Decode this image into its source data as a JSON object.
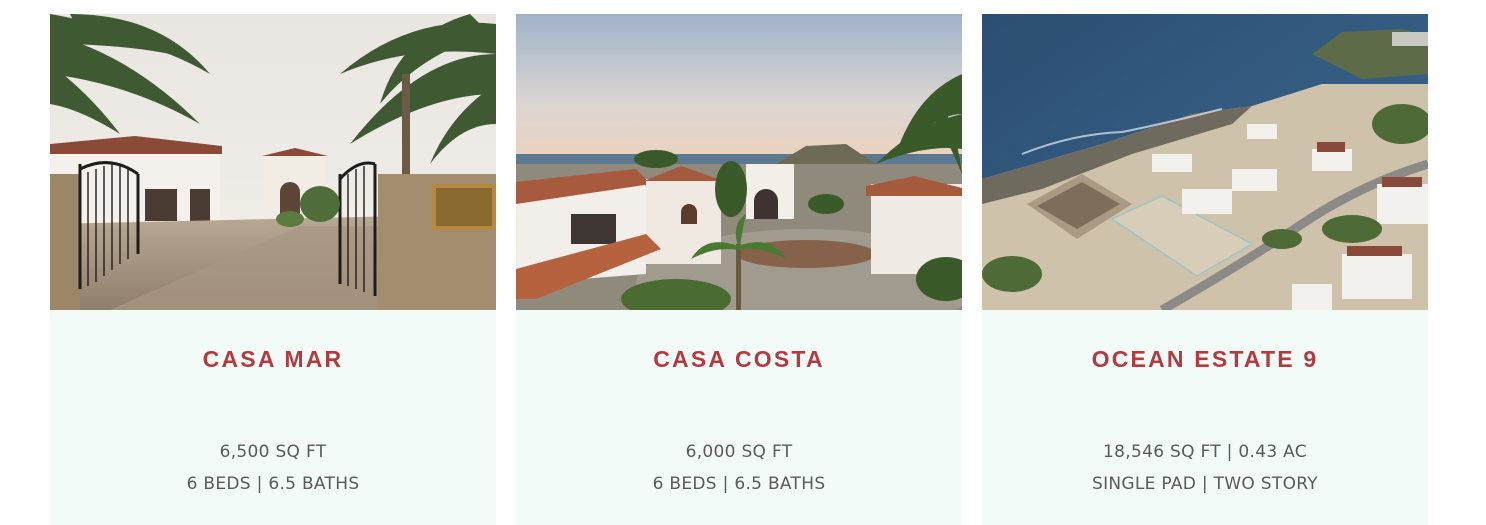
{
  "listings": [
    {
      "title": "CASA MAR",
      "line1": "6,500 SQ FT",
      "line2": "6 BEDS | 6.5 BATHS",
      "photo_icon": "villa-gate-photo"
    },
    {
      "title": "CASA COSTA",
      "line1": "6,000 SQ FT",
      "line2": "6 BEDS | 6.5 BATHS",
      "photo_icon": "villa-courtyard-photo"
    },
    {
      "title": "OCEAN ESTATE 9",
      "line1": "18,546 SQ FT | 0.43 AC",
      "line2": "SINGLE PAD | TWO STORY",
      "photo_icon": "aerial-coast-photo"
    }
  ],
  "colors": {
    "title": "#b33a3e",
    "card_bg": "#f3fbf9",
    "spec_text": "#5a5a5a"
  }
}
